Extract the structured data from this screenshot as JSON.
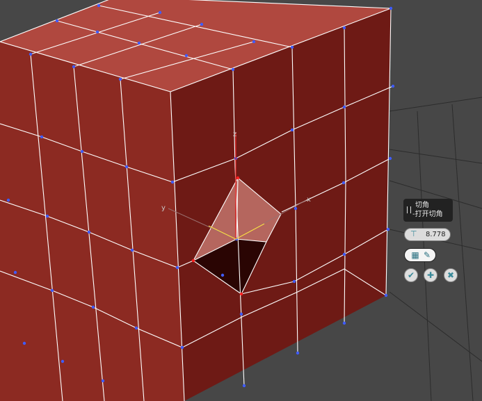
{
  "caddy": {
    "title_line1": "切角",
    "title_line2": "-打开切角",
    "amount_value": "8.778",
    "spinner_icon": "chamfer-amount-icon",
    "toggle_icons": [
      "grid-segments-icon",
      "open-chamfer-icon"
    ],
    "buttons": [
      {
        "name": "ok",
        "glyph": "✔",
        "icon": "checkmark-icon"
      },
      {
        "name": "apply",
        "glyph": "✚",
        "icon": "plus-icon"
      },
      {
        "name": "cancel",
        "glyph": "✖",
        "icon": "x-icon"
      }
    ]
  },
  "gizmo": {
    "x_label": "x",
    "y_label": "y",
    "z_label": "z"
  },
  "colors": {
    "viewport_bg": "#474747",
    "mesh_front": "#6e1a15",
    "mesh_side": "#8c2a22",
    "mesh_top": "#b0483f",
    "wire": "#ffffff",
    "vertex": "#3f5cff"
  }
}
